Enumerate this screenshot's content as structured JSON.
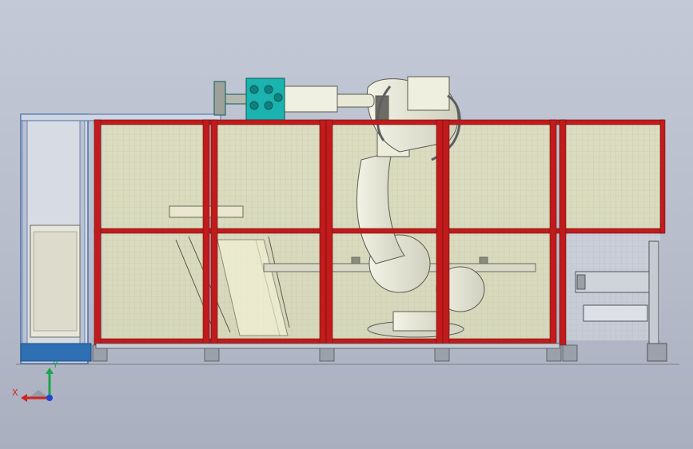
{
  "triad": {
    "x_label": "X",
    "y_label": "Y"
  },
  "colors": {
    "background_top": "#c3c9d6",
    "background_bottom": "#a9afbe",
    "frame_red": "#c11b1b",
    "frame_grey": "#8d939c",
    "mesh_yellow": "#f2ee9c",
    "mesh_line": "#d6d58a",
    "robot_body": "#e9ead8",
    "gripper_teal": "#1bb3b0",
    "base_blue": "#2f6fb3",
    "axis_x": "#d2241f",
    "axis_y": "#19a64a",
    "axis_z": "#2242d8"
  }
}
